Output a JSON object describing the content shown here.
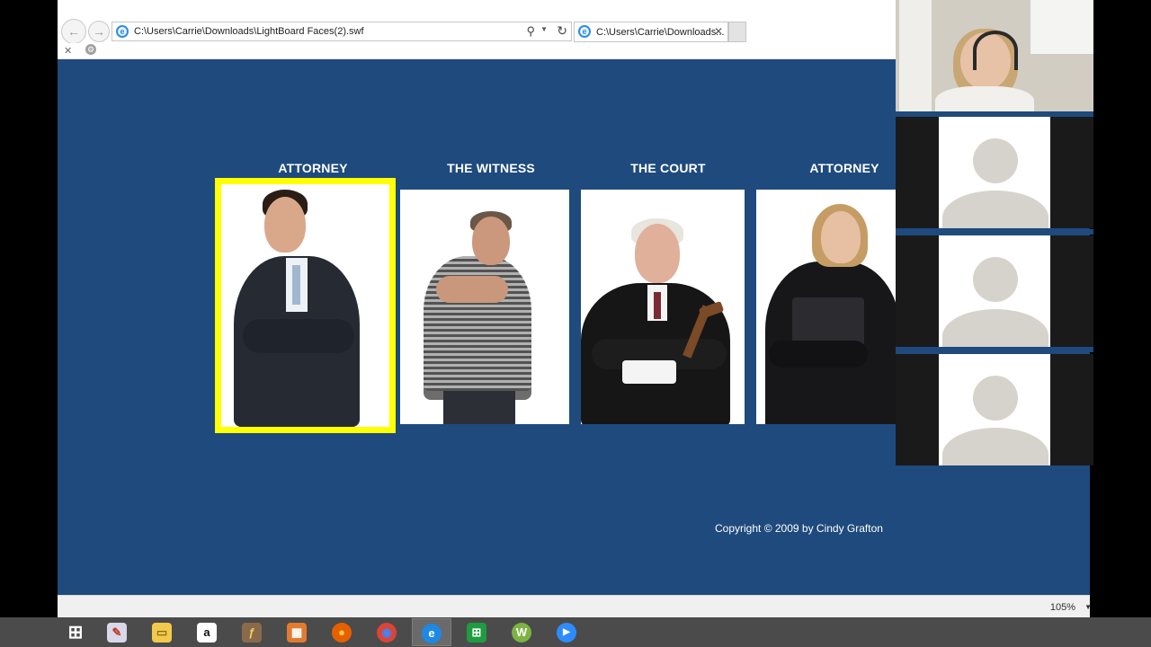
{
  "browser": {
    "address_url": "C:\\Users\\Carrie\\Downloads\\LightBoard Faces(2).swf",
    "tab_title": "C:\\Users\\Carrie\\Downloads...",
    "tab_close": "✕",
    "back_glyph": "←",
    "forward_glyph": "→",
    "search_glyph": "⚲",
    "refresh_glyph": "↻",
    "dropdown_glyph": "▼",
    "ie_glyph": "e",
    "cmd_close": "✕",
    "cmd_gear": "⚙",
    "zoom_level": "105%"
  },
  "cards": [
    {
      "label": "ATTORNEY",
      "selected": true,
      "person": "male-attorney"
    },
    {
      "label": "THE WITNESS",
      "selected": false,
      "person": "witness"
    },
    {
      "label": "THE COURT",
      "selected": false,
      "person": "judge"
    },
    {
      "label": "ATTORNEY",
      "selected": false,
      "person": "female-attorney"
    }
  ],
  "copyright": "Copyright © 2009 by Cindy Grafton",
  "colors": {
    "stage": "#1f4a7d",
    "selection": "#ffff00",
    "taskbar": "#4b4b4b"
  },
  "video_panel": {
    "participants": [
      "placeholder-avatar",
      "placeholder-avatar",
      "placeholder-avatar"
    ]
  },
  "taskbar": {
    "items": [
      {
        "icon": "windows-start-icon",
        "glyph": "⊞"
      },
      {
        "icon": "paint-icon",
        "glyph": "✎"
      },
      {
        "icon": "file-explorer-icon",
        "glyph": "▭"
      },
      {
        "icon": "amazon-icon",
        "glyph": "a"
      },
      {
        "icon": "flash-icon",
        "glyph": "ƒ"
      },
      {
        "icon": "gallery-icon",
        "glyph": "▦"
      },
      {
        "icon": "firefox-icon",
        "glyph": "●"
      },
      {
        "icon": "chrome-icon",
        "glyph": "◉"
      },
      {
        "icon": "internet-explorer-icon",
        "glyph": "e"
      },
      {
        "icon": "store-icon",
        "glyph": "⊞"
      },
      {
        "icon": "webroot-icon",
        "glyph": "W"
      },
      {
        "icon": "zoom-icon",
        "glyph": "▶"
      }
    ]
  }
}
